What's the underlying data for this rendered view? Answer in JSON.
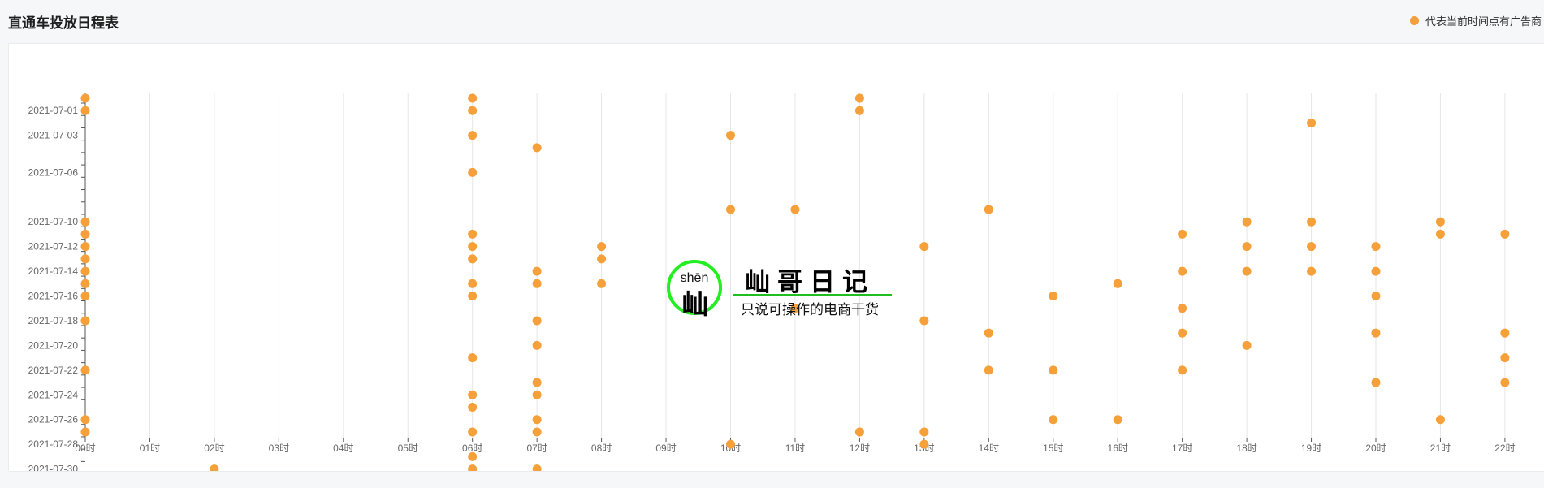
{
  "page": {
    "title": "直通车投放日程表",
    "legend_label": "代表当前时间点有广告商",
    "colors": {
      "point": "#f5a03a",
      "grid": "#e6e6e6",
      "axis": "#555555",
      "label": "#666666"
    }
  },
  "watermark": {
    "pinyin": "shēn",
    "char": "屾",
    "title": "屾哥日记",
    "tagline": "只说可操作的电商干货"
  },
  "chart_data": {
    "type": "scatter",
    "title": "直通车投放日程表",
    "legend": [
      {
        "name": "代表当前时间点有广告商",
        "marker": "circle",
        "position": "top-right"
      }
    ],
    "x_categories": [
      "00时",
      "01时",
      "02时",
      "03时",
      "04时",
      "05时",
      "06时",
      "07时",
      "08时",
      "09时",
      "10时",
      "11时",
      "12时",
      "13时",
      "14时",
      "15时",
      "16时",
      "17时",
      "18时",
      "19时",
      "20时",
      "21时",
      "22时"
    ],
    "y_categories": [
      "2021-06-30",
      "2021-07-01",
      "2021-07-02",
      "2021-07-03",
      "2021-07-04",
      "2021-07-05",
      "2021-07-06",
      "2021-07-07",
      "2021-07-08",
      "2021-07-09",
      "2021-07-10",
      "2021-07-11",
      "2021-07-12",
      "2021-07-13",
      "2021-07-14",
      "2021-07-15",
      "2021-07-16",
      "2021-07-17",
      "2021-07-18",
      "2021-07-19",
      "2021-07-20",
      "2021-07-21",
      "2021-07-22",
      "2021-07-23",
      "2021-07-24",
      "2021-07-25",
      "2021-07-26",
      "2021-07-27",
      "2021-07-28",
      "2021-07-29",
      "2021-07-30"
    ],
    "y_tick_labels": [
      "2021-07-01",
      "2021-07-03",
      "2021-07-06",
      "2021-07-10",
      "2021-07-12",
      "2021-07-14",
      "2021-07-16",
      "2021-07-18",
      "2021-07-20",
      "2021-07-22",
      "2021-07-24",
      "2021-07-26",
      "2021-07-28",
      "2021-07-30"
    ],
    "grid": {
      "vertical": true,
      "horizontal": false
    },
    "points": [
      [
        "00时",
        "2021-06-30"
      ],
      [
        "00时",
        "2021-07-01"
      ],
      [
        "00时",
        "2021-07-10"
      ],
      [
        "00时",
        "2021-07-11"
      ],
      [
        "00时",
        "2021-07-12"
      ],
      [
        "00时",
        "2021-07-13"
      ],
      [
        "00时",
        "2021-07-14"
      ],
      [
        "00时",
        "2021-07-15"
      ],
      [
        "00时",
        "2021-07-16"
      ],
      [
        "00时",
        "2021-07-18"
      ],
      [
        "00时",
        "2021-07-22"
      ],
      [
        "00时",
        "2021-07-26"
      ],
      [
        "00时",
        "2021-07-27"
      ],
      [
        "02时",
        "2021-07-30"
      ],
      [
        "06时",
        "2021-06-30"
      ],
      [
        "06时",
        "2021-07-01"
      ],
      [
        "06时",
        "2021-07-03"
      ],
      [
        "06时",
        "2021-07-06"
      ],
      [
        "06时",
        "2021-07-11"
      ],
      [
        "06时",
        "2021-07-12"
      ],
      [
        "06时",
        "2021-07-13"
      ],
      [
        "06时",
        "2021-07-15"
      ],
      [
        "06时",
        "2021-07-16"
      ],
      [
        "06时",
        "2021-07-21"
      ],
      [
        "06时",
        "2021-07-24"
      ],
      [
        "06时",
        "2021-07-25"
      ],
      [
        "06时",
        "2021-07-27"
      ],
      [
        "06时",
        "2021-07-29"
      ],
      [
        "06时",
        "2021-07-30"
      ],
      [
        "07时",
        "2021-07-04"
      ],
      [
        "07时",
        "2021-07-14"
      ],
      [
        "07时",
        "2021-07-15"
      ],
      [
        "07时",
        "2021-07-18"
      ],
      [
        "07时",
        "2021-07-20"
      ],
      [
        "07时",
        "2021-07-23"
      ],
      [
        "07时",
        "2021-07-24"
      ],
      [
        "07时",
        "2021-07-26"
      ],
      [
        "07时",
        "2021-07-27"
      ],
      [
        "07时",
        "2021-07-30"
      ],
      [
        "08时",
        "2021-07-12"
      ],
      [
        "08时",
        "2021-07-13"
      ],
      [
        "08时",
        "2021-07-15"
      ],
      [
        "10时",
        "2021-07-03"
      ],
      [
        "10时",
        "2021-07-09"
      ],
      [
        "10时",
        "2021-07-28"
      ],
      [
        "11时",
        "2021-07-09"
      ],
      [
        "11时",
        "2021-07-17"
      ],
      [
        "12时",
        "2021-06-30"
      ],
      [
        "12时",
        "2021-07-01"
      ],
      [
        "12时",
        "2021-07-27"
      ],
      [
        "13时",
        "2021-07-12"
      ],
      [
        "13时",
        "2021-07-18"
      ],
      [
        "13时",
        "2021-07-27"
      ],
      [
        "13时",
        "2021-07-28"
      ],
      [
        "14时",
        "2021-07-09"
      ],
      [
        "14时",
        "2021-07-19"
      ],
      [
        "14时",
        "2021-07-22"
      ],
      [
        "15时",
        "2021-07-16"
      ],
      [
        "15时",
        "2021-07-22"
      ],
      [
        "15时",
        "2021-07-26"
      ],
      [
        "16时",
        "2021-07-15"
      ],
      [
        "16时",
        "2021-07-26"
      ],
      [
        "17时",
        "2021-07-11"
      ],
      [
        "17时",
        "2021-07-14"
      ],
      [
        "17时",
        "2021-07-17"
      ],
      [
        "17时",
        "2021-07-19"
      ],
      [
        "17时",
        "2021-07-22"
      ],
      [
        "18时",
        "2021-07-10"
      ],
      [
        "18时",
        "2021-07-12"
      ],
      [
        "18时",
        "2021-07-14"
      ],
      [
        "18时",
        "2021-07-20"
      ],
      [
        "19时",
        "2021-07-02"
      ],
      [
        "19时",
        "2021-07-10"
      ],
      [
        "19时",
        "2021-07-12"
      ],
      [
        "19时",
        "2021-07-14"
      ],
      [
        "20时",
        "2021-07-12"
      ],
      [
        "20时",
        "2021-07-14"
      ],
      [
        "20时",
        "2021-07-16"
      ],
      [
        "20时",
        "2021-07-19"
      ],
      [
        "20时",
        "2021-07-23"
      ],
      [
        "21时",
        "2021-07-10"
      ],
      [
        "21时",
        "2021-07-11"
      ],
      [
        "21时",
        "2021-07-26"
      ],
      [
        "22时",
        "2021-07-11"
      ],
      [
        "22时",
        "2021-07-19"
      ],
      [
        "22时",
        "2021-07-21"
      ],
      [
        "22时",
        "2021-07-23"
      ]
    ]
  }
}
